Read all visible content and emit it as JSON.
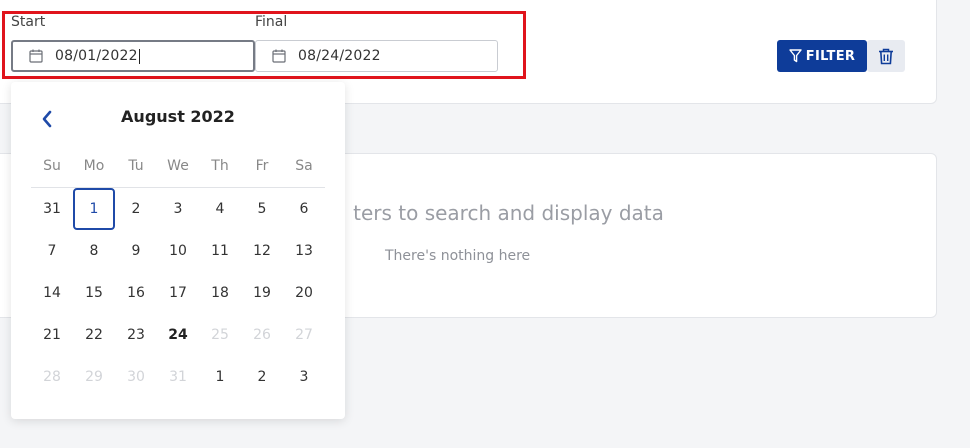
{
  "filters": {
    "start_label": "Start",
    "start_value": "08/01/2022",
    "final_label": "Final",
    "final_value": "08/24/2022",
    "filter_button": "FILTER"
  },
  "results": {
    "empty_title": "Select filters to search and display data",
    "empty_title_visible": "ters to search and display data",
    "empty_subtitle": "There's nothing here"
  },
  "calendar": {
    "month_title": "August 2022",
    "weekdays": [
      "Su",
      "Mo",
      "Tu",
      "We",
      "Th",
      "Fr",
      "Sa"
    ],
    "days": [
      {
        "label": "31",
        "state": "outside-prev"
      },
      {
        "label": "1",
        "state": "selected"
      },
      {
        "label": "2",
        "state": "normal"
      },
      {
        "label": "3",
        "state": "normal"
      },
      {
        "label": "4",
        "state": "normal"
      },
      {
        "label": "5",
        "state": "normal"
      },
      {
        "label": "6",
        "state": "normal"
      },
      {
        "label": "7",
        "state": "normal"
      },
      {
        "label": "8",
        "state": "normal"
      },
      {
        "label": "9",
        "state": "normal"
      },
      {
        "label": "10",
        "state": "normal"
      },
      {
        "label": "11",
        "state": "normal"
      },
      {
        "label": "12",
        "state": "normal"
      },
      {
        "label": "13",
        "state": "normal"
      },
      {
        "label": "14",
        "state": "normal"
      },
      {
        "label": "15",
        "state": "normal"
      },
      {
        "label": "16",
        "state": "normal"
      },
      {
        "label": "17",
        "state": "normal"
      },
      {
        "label": "18",
        "state": "normal"
      },
      {
        "label": "19",
        "state": "normal"
      },
      {
        "label": "20",
        "state": "normal"
      },
      {
        "label": "21",
        "state": "normal"
      },
      {
        "label": "22",
        "state": "normal"
      },
      {
        "label": "23",
        "state": "normal"
      },
      {
        "label": "24",
        "state": "today"
      },
      {
        "label": "25",
        "state": "disabled"
      },
      {
        "label": "26",
        "state": "disabled"
      },
      {
        "label": "27",
        "state": "disabled"
      },
      {
        "label": "28",
        "state": "disabled"
      },
      {
        "label": "29",
        "state": "disabled"
      },
      {
        "label": "30",
        "state": "disabled"
      },
      {
        "label": "31",
        "state": "disabled"
      },
      {
        "label": "1",
        "state": "outside-next"
      },
      {
        "label": "2",
        "state": "outside-next"
      },
      {
        "label": "3",
        "state": "outside-next"
      }
    ]
  },
  "colors": {
    "primary": "#0e3c99",
    "highlight": "#e0141c",
    "selected_day": "#1f4aa8"
  },
  "icons": {
    "date_input": "calendar-icon",
    "filter_button": "filter-funnel-icon",
    "clear_button": "trash-icon",
    "prev_month": "chevron-left-icon"
  }
}
